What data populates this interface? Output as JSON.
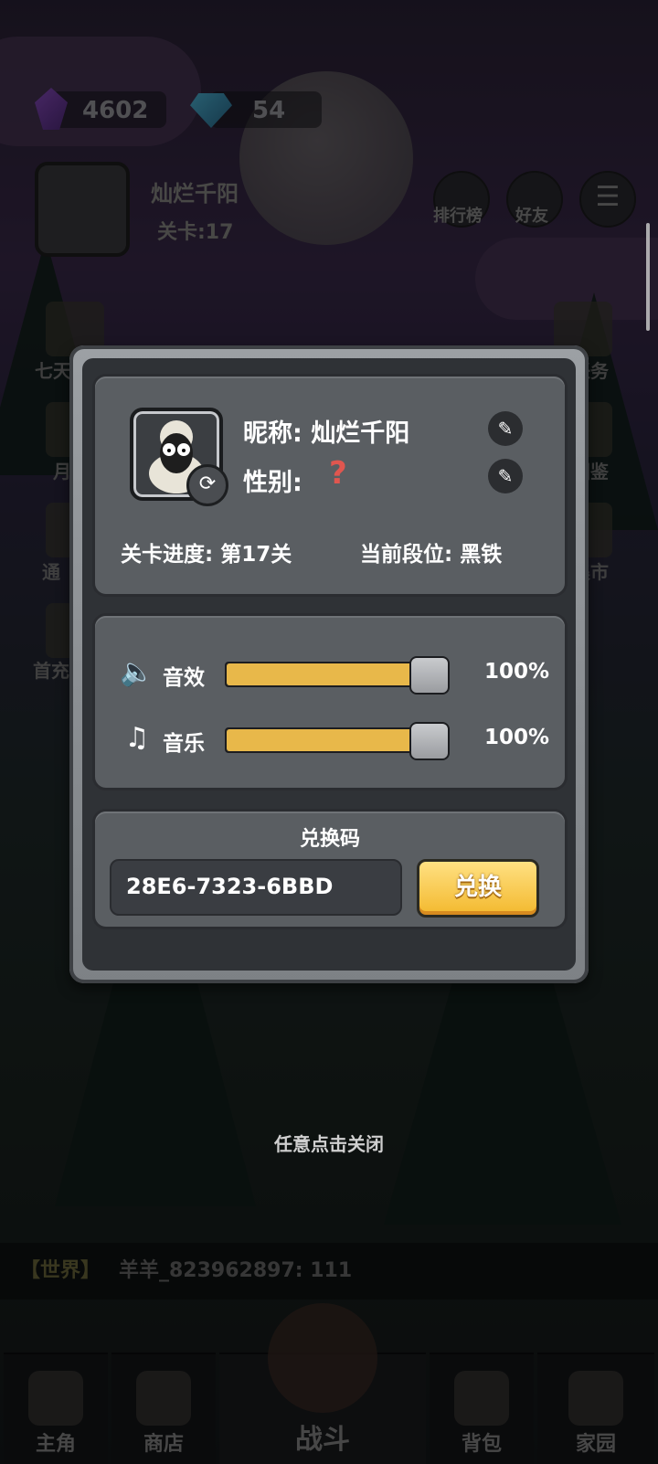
{
  "resources": {
    "crystal": "4602",
    "diamond": "54"
  },
  "player": {
    "name": "灿烂千阳",
    "level_label": "关卡:17"
  },
  "top_buttons": [
    {
      "label": "排行榜"
    },
    {
      "label": "好友"
    }
  ],
  "side_left": [
    {
      "label": "七天"
    },
    {
      "label": "月"
    },
    {
      "label": "通"
    },
    {
      "label": "首充"
    }
  ],
  "side_right": [
    {
      "label": "任务"
    },
    {
      "label": "图鉴"
    },
    {
      "label": "集市"
    }
  ],
  "dialog": {
    "profile": {
      "nickname_label": "昵称: 灿烂千阳",
      "gender_label": "性别:",
      "gender_value": "?",
      "progress_label": "关卡进度: 第17关",
      "rank_label": "当前段位: 黑铁"
    },
    "settings": {
      "sound": {
        "label": "音效",
        "value": 100,
        "value_text": "100%"
      },
      "music": {
        "label": "音乐",
        "value": 100,
        "value_text": "100%"
      }
    },
    "redeem": {
      "title": "兑换码",
      "code": "28E6-7323-6BBD",
      "button": "兑换"
    }
  },
  "close_hint": "任意点击关闭",
  "chat": {
    "channel": "【世界】",
    "message": "羊羊_823962897: 111"
  },
  "nav": [
    {
      "label": "主角"
    },
    {
      "label": "商店"
    },
    {
      "label": "战斗"
    },
    {
      "label": "背包"
    },
    {
      "label": "家园"
    }
  ],
  "colors": {
    "accent": "#e8b84a",
    "panel": "#5a5e62",
    "button": "#f3b92e"
  }
}
